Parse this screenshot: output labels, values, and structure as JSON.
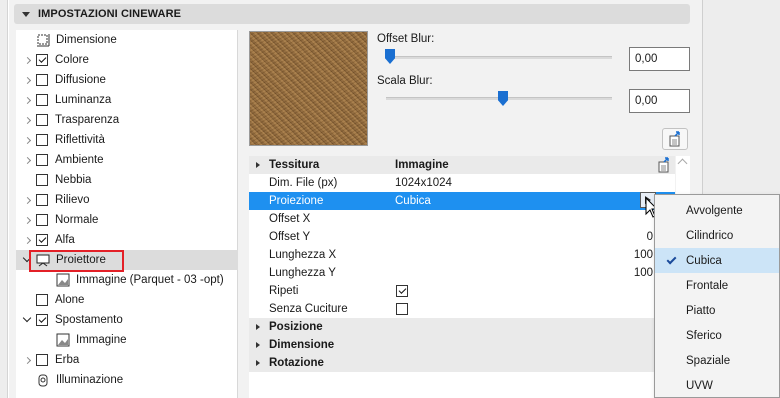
{
  "section": {
    "title": "IMPOSTAZIONI CINEWARE"
  },
  "tree": {
    "items": [
      {
        "label": "Dimensione",
        "kind": "icon",
        "icon": "dimension-icon"
      },
      {
        "label": "Colore",
        "expandable": true,
        "checked": true
      },
      {
        "label": "Diffusione",
        "expandable": true,
        "checked": false
      },
      {
        "label": "Luminanza",
        "expandable": true,
        "checked": false
      },
      {
        "label": "Trasparenza",
        "expandable": true,
        "checked": false
      },
      {
        "label": "Riflettività",
        "expandable": true,
        "checked": false
      },
      {
        "label": "Ambiente",
        "expandable": true,
        "checked": false
      },
      {
        "label": "Nebbia",
        "expandable": false,
        "checked": false
      },
      {
        "label": "Rilievo",
        "expandable": true,
        "checked": false
      },
      {
        "label": "Normale",
        "expandable": true,
        "checked": false
      },
      {
        "label": "Alfa",
        "expandable": true,
        "checked": true
      },
      {
        "label": "Proiettore",
        "kind": "icon",
        "icon": "projector-icon",
        "expanded": true,
        "selected": true
      },
      {
        "label": "Immagine (Parquet - 03 -opt)",
        "kind": "icon",
        "icon": "image-icon",
        "child": true
      },
      {
        "label": "Alone",
        "expandable": false,
        "checked": false
      },
      {
        "label": "Spostamento",
        "expanded": true,
        "checked": true
      },
      {
        "label": "Immagine",
        "kind": "icon",
        "icon": "image-icon",
        "child": true
      },
      {
        "label": "Erba",
        "expandable": true,
        "checked": false
      },
      {
        "label": "Illuminazione",
        "kind": "icon",
        "icon": "lamp-icon"
      }
    ]
  },
  "blur": {
    "offset_label": "Offset Blur:",
    "offset_value": "0,00",
    "offset_level": 0.0,
    "scale_label": "Scala Blur:",
    "scale_value": "0,00",
    "scale_level": 0.5
  },
  "table": {
    "rows": [
      {
        "type": "group",
        "label": "Tessitura",
        "value": "Immagine"
      },
      {
        "type": "prop",
        "label": "Dim. File (px)",
        "value": "1024x1024"
      },
      {
        "type": "prop",
        "label": "Proiezione",
        "value": "Cubica",
        "selected": true
      },
      {
        "type": "prop",
        "label": "Offset X",
        "right": ""
      },
      {
        "type": "prop",
        "label": "Offset Y",
        "right": "0"
      },
      {
        "type": "prop",
        "label": "Lunghezza X",
        "right": "100"
      },
      {
        "type": "prop",
        "label": "Lunghezza Y",
        "right": "100"
      },
      {
        "type": "check",
        "label": "Ripeti",
        "checked": true
      },
      {
        "type": "check",
        "label": "Senza Cuciture",
        "checked": false
      },
      {
        "type": "group",
        "label": "Posizione"
      },
      {
        "type": "group",
        "label": "Dimensione"
      },
      {
        "type": "group",
        "label": "Rotazione"
      }
    ]
  },
  "popup": {
    "items": [
      {
        "label": "Avvolgente",
        "checked": false
      },
      {
        "label": "Cilindrico",
        "checked": false
      },
      {
        "label": "Cubica",
        "checked": true
      },
      {
        "label": "Frontale",
        "checked": false
      },
      {
        "label": "Piatto",
        "checked": false
      },
      {
        "label": "Sferico",
        "checked": false
      },
      {
        "label": "Spaziale",
        "checked": false
      },
      {
        "label": "UVW",
        "checked": false
      }
    ]
  },
  "colors": {
    "selection_blue": "#1e90f0",
    "highlight_red": "#e32027",
    "slider_blue": "#1a6fd1"
  }
}
